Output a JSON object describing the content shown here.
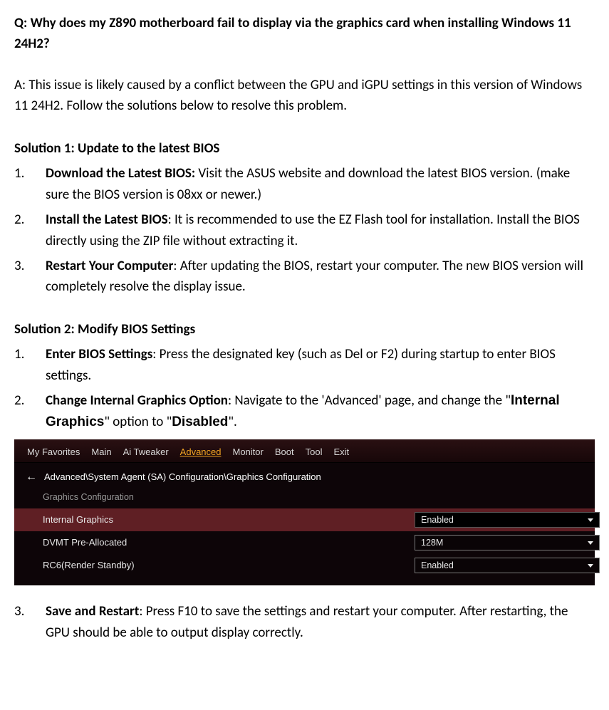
{
  "question": "Q: Why does my Z890 motherboard fail to display via the graphics card when installing Windows 11 24H2?",
  "answer": "A: This issue is likely caused by a conflict between the GPU and iGPU settings in this version of Windows 11 24H2. Follow the solutions below to resolve this problem.",
  "sol1": {
    "heading": "Solution 1: Update to the latest BIOS",
    "items": [
      {
        "num": "1.",
        "bold": "Download the Latest BIOS:",
        "rest": " Visit the ASUS website and download the latest BIOS version. (make sure the BIOS version is 08xx or newer.)"
      },
      {
        "num": "2.",
        "bold": "Install the Latest BIOS",
        "rest": ": It is recommended to use the EZ Flash tool for installation. Install the BIOS directly using the ZIP file without extracting it."
      },
      {
        "num": "3.",
        "bold": "Restart Your Computer",
        "rest": ": After updating the BIOS, restart your computer. The new BIOS version will completely resolve the display issue."
      }
    ]
  },
  "sol2": {
    "heading": "Solution 2: Modify BIOS Settings",
    "item1": {
      "num": "1.",
      "bold": "Enter BIOS Settings",
      "rest": ": Press the designated key (such as Del or F2) during startup to enter BIOS settings."
    },
    "item2": {
      "num": "2.",
      "bold": "Change Internal Graphics Option",
      "rest1": ": Navigate to the 'Advanced' page, and change the \"",
      "opt": "Internal Graphics",
      "rest2": "\" option to \"",
      "val": "Disabled",
      "rest3": "\"."
    },
    "item3": {
      "num": "3.",
      "bold": "Save and Restart",
      "rest": ": Press F10 to save the settings and restart your computer. After restarting, the GPU should be able to output display correctly."
    }
  },
  "bios": {
    "tabs": [
      "My Favorites",
      "Main",
      "Ai Tweaker",
      "Advanced",
      "Monitor",
      "Boot",
      "Tool",
      "Exit"
    ],
    "active_tab_index": 3,
    "breadcrumb_arrow": "←",
    "breadcrumb": "Advanced\\System Agent (SA) Configuration\\Graphics Configuration",
    "subheading": "Graphics Configuration",
    "rows": [
      {
        "label": "Internal Graphics",
        "value": "Enabled",
        "selected": true
      },
      {
        "label": "DVMT Pre-Allocated",
        "value": "128M",
        "selected": false
      },
      {
        "label": "RC6(Render Standby)",
        "value": "Enabled",
        "selected": false
      }
    ]
  }
}
